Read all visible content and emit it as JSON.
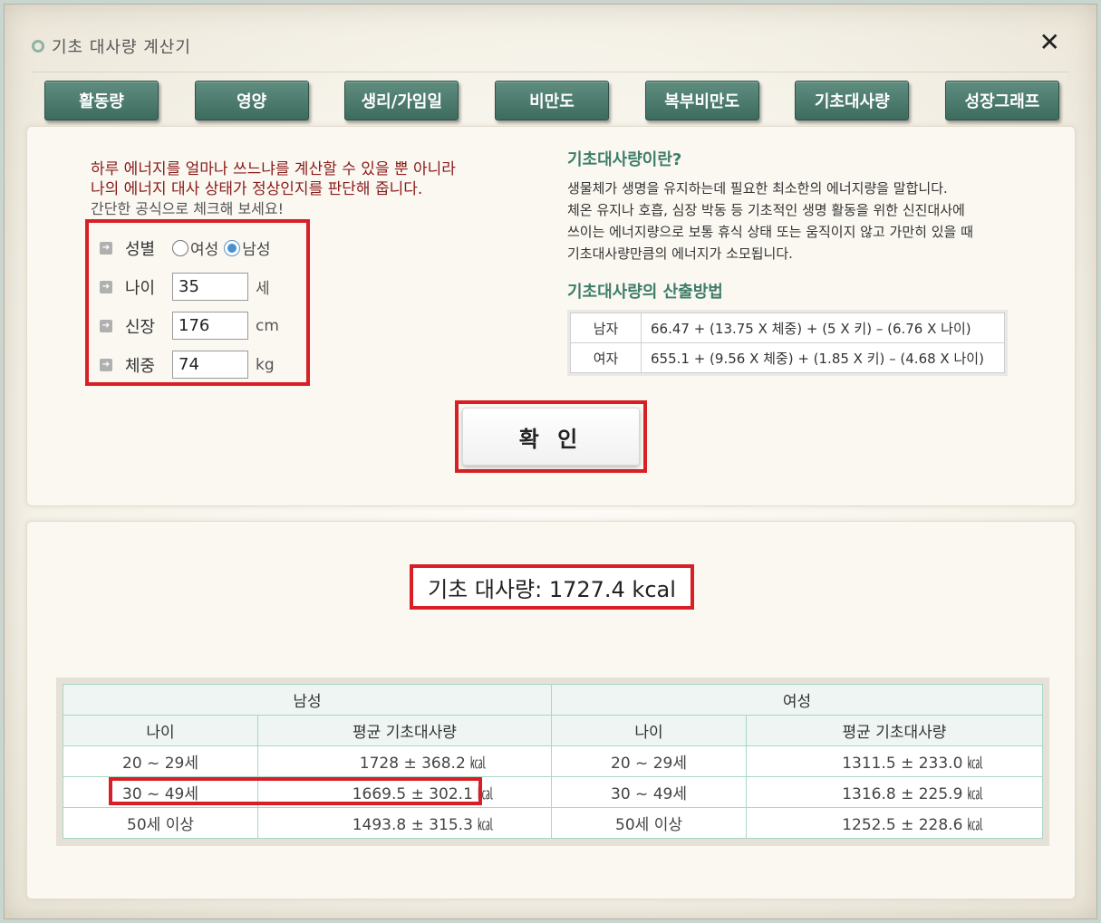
{
  "window": {
    "title": "기초 대사량 계산기",
    "close_label": "✕"
  },
  "tabs": [
    "활동량",
    "영양",
    "생리/가임일",
    "비만도",
    "복부비만도",
    "기초대사량",
    "성장그래프"
  ],
  "intro": {
    "line1": "하루 에너지를 얼마나 쓰느냐를 계산할 수 있을 뿐 아니라",
    "line2": "나의 에너지 대사 상태가 정상인지를 판단해 줍니다.",
    "line3": "간단한 공식으로 체크해 보세요!"
  },
  "form": {
    "gender_label": "성별",
    "gender_options": [
      "여성",
      "남성"
    ],
    "gender_selected": "남성",
    "age_label": "나이",
    "age_value": "35",
    "age_unit": "세",
    "height_label": "신장",
    "height_value": "176",
    "height_unit": "cm",
    "weight_label": "체중",
    "weight_value": "74",
    "weight_unit": "kg",
    "confirm_label": "확 인"
  },
  "info": {
    "title": "기초대사량이란?",
    "lines": [
      "생물체가 생명을 유지하는데 필요한 최소한의 에너지량을 말합니다.",
      "체온 유지나 호흡, 심장 박동 등 기초적인 생명 활동을 위한 신진대사에",
      "쓰이는 에너지량으로 보통 휴식 상태 또는 움직이지 않고 가만히 있을 때",
      "기초대사량만큼의 에너지가 소모됩니다."
    ],
    "method_title": "기초대사량의 산출방법",
    "formulas": [
      {
        "gender": "남자",
        "formula": "66.47 + (13.75 X 체중) + (5 X 키) – (6.76 X 나이)"
      },
      {
        "gender": "여자",
        "formula": "655.1 + (9.56 X 체중) + (1.85 X 키) – (4.68 X 나이)"
      }
    ]
  },
  "result": {
    "text": "기초 대사량: 1727.4 kcal"
  },
  "stats": {
    "male_header": "남성",
    "female_header": "여성",
    "age_header": "나이",
    "avg_header": "평균 기초대사량",
    "rows": [
      {
        "m_age": "20 ~ 29세",
        "m_val": "1728 ± 368.2 ㎉",
        "f_age": "20 ~ 29세",
        "f_val": "1311.5 ± 233.0 ㎉"
      },
      {
        "m_age": "30 ~ 49세",
        "m_val": "1669.5 ± 302.1 ㎉",
        "f_age": "30 ~ 49세",
        "f_val": "1316.8 ± 225.9 ㎉"
      },
      {
        "m_age": "50세 이상",
        "m_val": "1493.8 ± 315.3 ㎉",
        "f_age": "50세 이상",
        "f_val": "1252.5 ± 228.6 ㎉"
      }
    ]
  }
}
